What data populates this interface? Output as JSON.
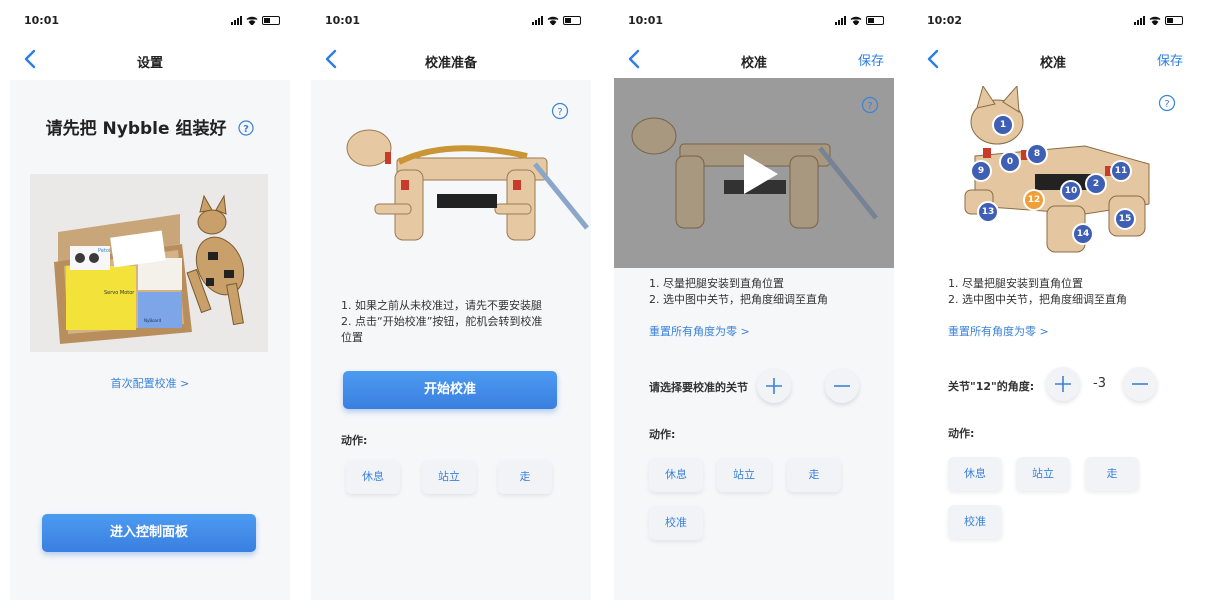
{
  "status": {
    "time_a": "10:01",
    "time_b": "10:01",
    "time_c": "10:01",
    "time_d": "10:02"
  },
  "screen1": {
    "title": "设置",
    "heading": "请先把 Nybble 组装好",
    "first_calibration_link": "首次配置校准 >",
    "enter_button": "进入控制面板",
    "photo_labels": {
      "box_brand": "Petoi",
      "board_label": "Servo Motor",
      "card_label": "NyBoard"
    }
  },
  "screen2": {
    "title": "校准准备",
    "instructions": [
      "1. 如果之前从未校准过，请先不要安装腿",
      "2. 点击“开始校准”按钮，舵机会转到校准",
      "位置"
    ],
    "start_button": "开始校准",
    "actions_label": "动作:",
    "actions": [
      "休息",
      "站立",
      "走"
    ]
  },
  "screen3": {
    "title": "校准",
    "save": "保存",
    "instructions": [
      "1. 尽量把腿安装到直角位置",
      "2. 选中图中关节，把角度细调至直角"
    ],
    "reset_link": "重置所有角度为零 >",
    "joint_prompt": "请选择要校准的关节",
    "actions_label": "动作:",
    "actions": [
      "休息",
      "站立",
      "走",
      "校准"
    ]
  },
  "screen4": {
    "title": "校准",
    "save": "保存",
    "instructions": [
      "1. 尽量把腿安装到直角位置",
      "2. 选中图中关节，把角度细调至直角"
    ],
    "reset_link": "重置所有角度为零 >",
    "joint_prompt": "关节\"12\"的角度:",
    "joint_value": "-3",
    "selected_joint": "12",
    "joints": [
      "1",
      "0",
      "8",
      "9",
      "10",
      "2",
      "11",
      "12",
      "13",
      "15",
      "14"
    ],
    "actions_label": "动作:",
    "actions": [
      "休息",
      "站立",
      "走",
      "校准"
    ]
  },
  "colors": {
    "accent": "#3b82d9",
    "selected_joint": "#f0a038",
    "joint": "#3f5fb5"
  },
  "icons": {
    "back": "chevron-left-icon",
    "help": "question-circle-icon",
    "play": "play-icon",
    "plus": "plus-icon",
    "minus": "minus-icon",
    "status": [
      "signal-icon",
      "wifi-icon",
      "battery-icon"
    ]
  }
}
